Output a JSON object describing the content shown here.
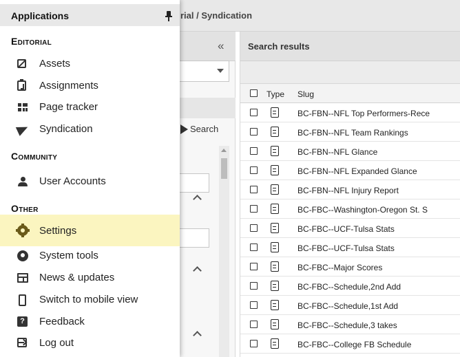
{
  "breadcrumb": "rial / Syndication",
  "left_pane": {
    "collapse_glyph": "«",
    "search_button": "Search"
  },
  "results": {
    "title": "Search results",
    "columns": {
      "type": "Type",
      "slug": "Slug"
    },
    "rows": [
      "BC-FBN--NFL Top Performers-Rece",
      "BC-FBN--NFL Team Rankings",
      "BC-FBN--NFL Glance",
      "BC-FBN--NFL Expanded Glance",
      "BC-FBN--NFL Injury Report",
      "BC-FBC--Washington-Oregon St. S",
      "BC-FBC--UCF-Tulsa Stats",
      "BC-FBC--UCF-Tulsa Stats",
      "BC-FBC--Major Scores",
      "BC-FBC--Schedule,2nd Add",
      "BC-FBC--Schedule,1st Add",
      "BC-FBC--Schedule,3 takes",
      "BC-FBC--College FB Schedule"
    ]
  },
  "drawer": {
    "title": "Applications",
    "pin_icon": "pin-icon",
    "sections": {
      "editorial": "Editorial",
      "community": "Community",
      "other": "Other"
    },
    "items": {
      "assets": "Assets",
      "assignments": "Assignments",
      "page_tracker": "Page tracker",
      "syndication": "Syndication",
      "user_accounts": "User Accounts",
      "settings": "Settings",
      "system_tools": "System tools",
      "news_updates": "News & updates",
      "switch_mobile": "Switch to mobile view",
      "feedback": "Feedback",
      "log_out": "Log out"
    },
    "highlight_color": "#fbf5c0"
  }
}
